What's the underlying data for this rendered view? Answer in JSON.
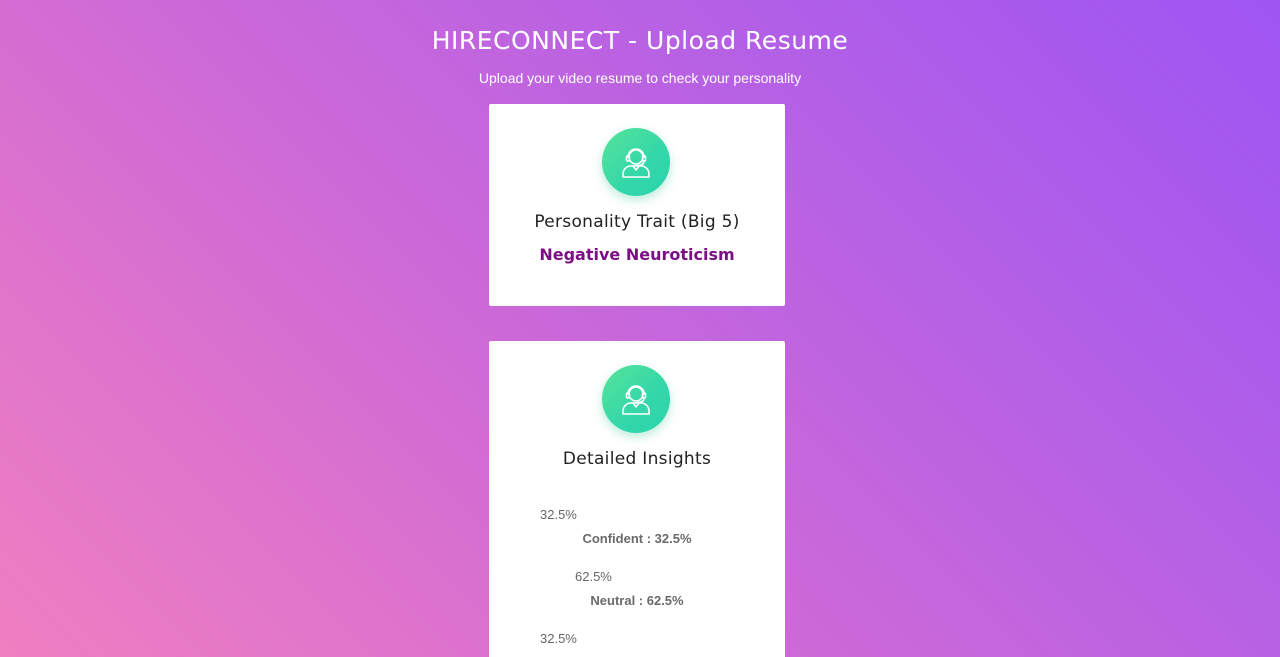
{
  "header": {
    "title": "HIRECONNECT - Upload Resume",
    "subtitle": "Upload your video resume to check your personality"
  },
  "trait_card": {
    "icon": "user-headset-icon",
    "heading": "Personality Trait (Big 5)",
    "value": "Negative Neuroticism"
  },
  "insights_card": {
    "icon": "user-headset-icon",
    "heading": "Detailed Insights",
    "items": [
      {
        "pct": "32.5%",
        "label": "Confident : 32.5%",
        "value": 32.5
      },
      {
        "pct": "62.5%",
        "label": "Neutral : 62.5%",
        "value": 62.5
      },
      {
        "pct": "32.5%",
        "label": "",
        "value": 32.5
      }
    ]
  },
  "colors": {
    "background_start": "#f07fc0",
    "background_end": "#9f55f3",
    "avatar_green": "#3dd9a5",
    "trait_accent": "#7d0f86"
  }
}
